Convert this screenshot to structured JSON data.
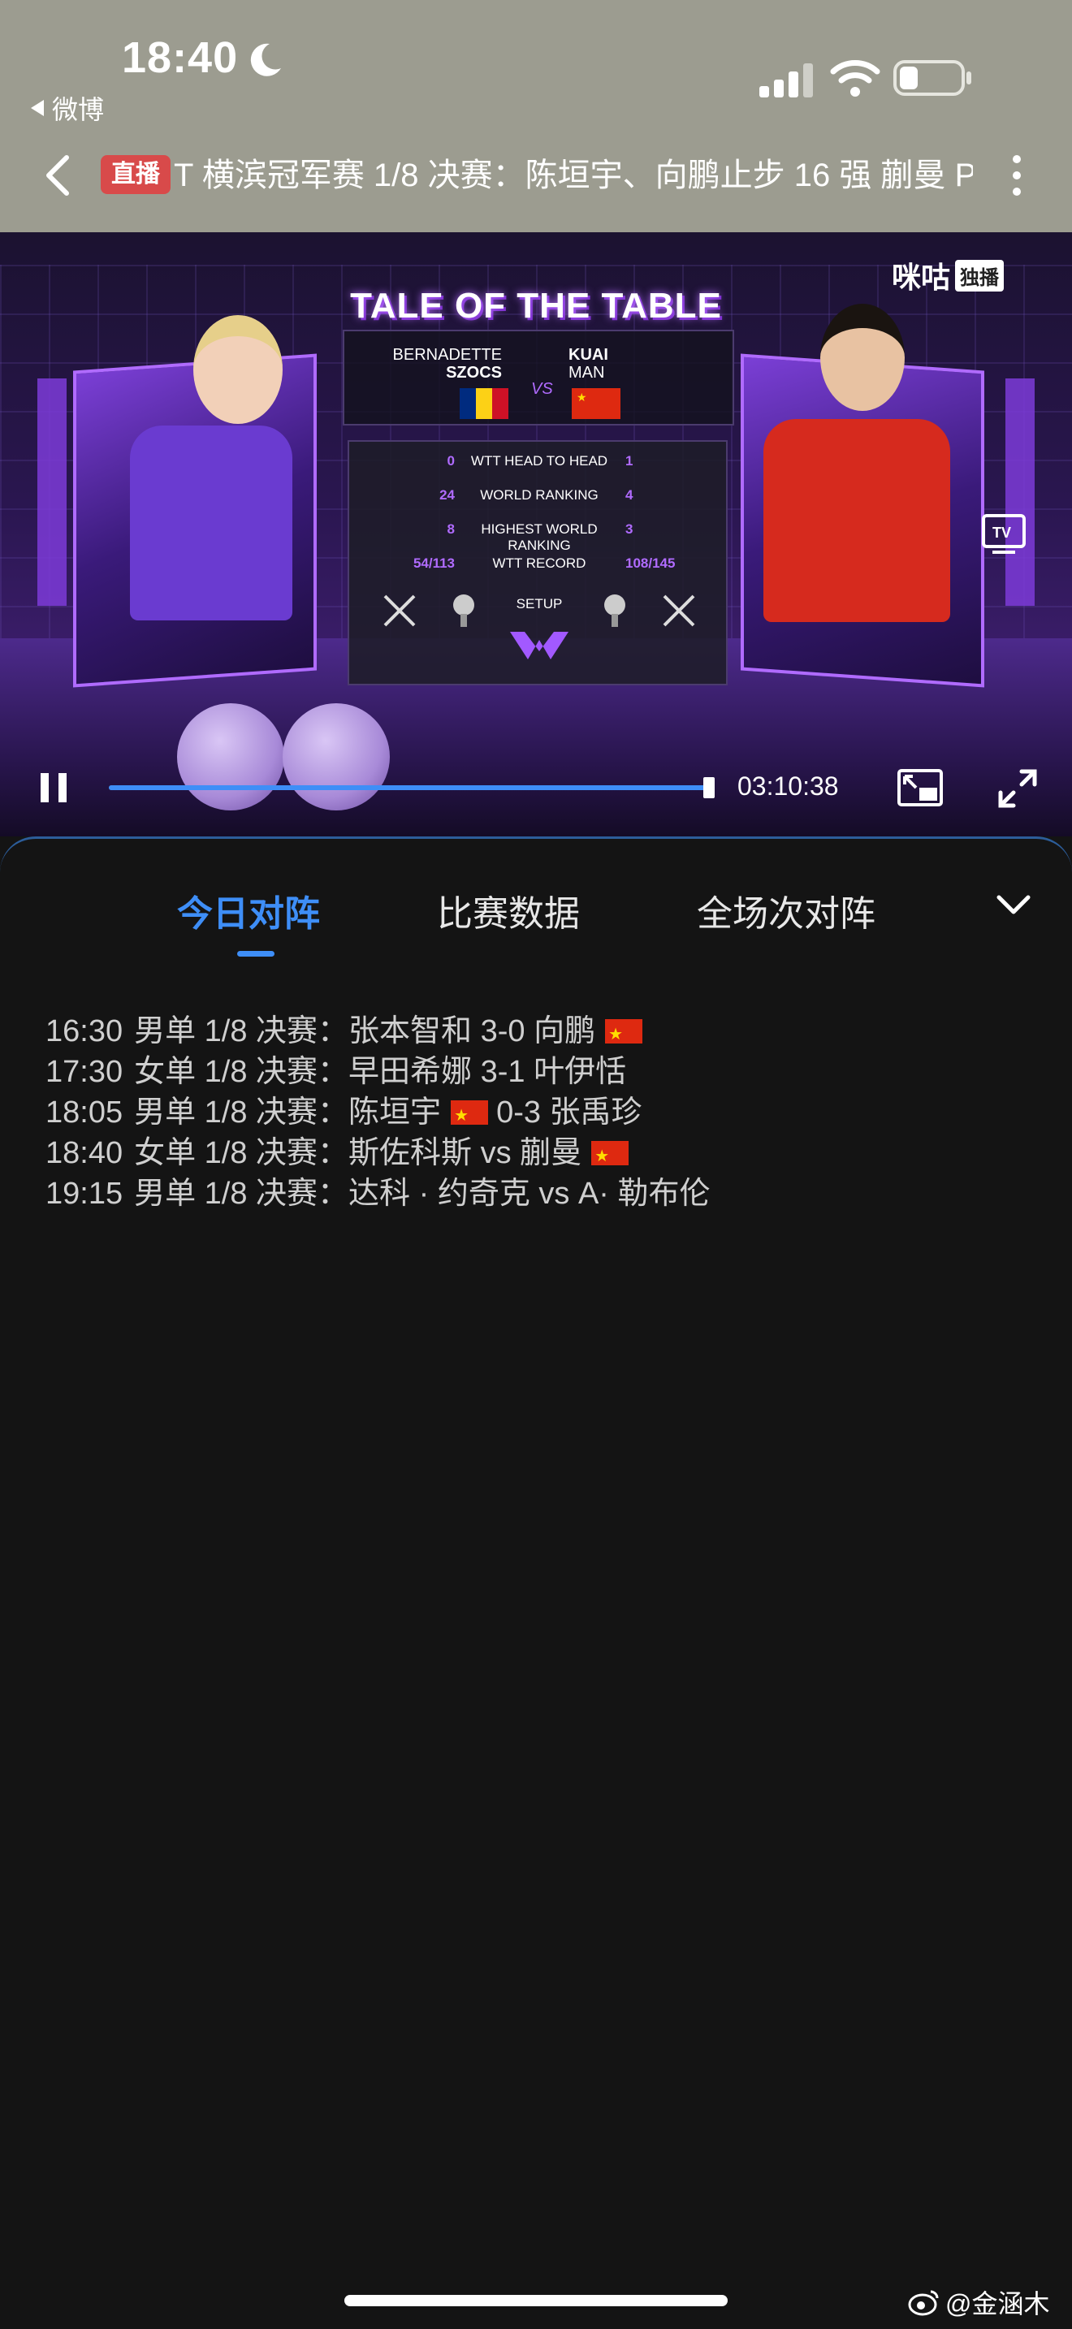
{
  "status_bar": {
    "time": "18:40",
    "back_app_label": "微博"
  },
  "header": {
    "live_badge": "直播",
    "title": "T 横滨冠军赛 1/8 决赛：陈垣宇、向鹏止步 16 强 蒯曼 P"
  },
  "video": {
    "channel_logo": "咪咕",
    "channel_tag": "独播",
    "overlay_title": "TALE OF THE TABLE",
    "player_left": {
      "first": "BERNADETTE",
      "last": "SZOCS"
    },
    "player_right": {
      "first": "KUAI",
      "last": "MAN"
    },
    "vs": "VS",
    "stats": [
      {
        "left": "0",
        "label": "WTT HEAD TO HEAD",
        "right": "1"
      },
      {
        "left": "24",
        "label": "WORLD RANKING",
        "right": "4"
      },
      {
        "left": "8",
        "label": "HIGHEST WORLD RANKING",
        "right": "3"
      },
      {
        "left": "54/113",
        "label": "WTT RECORD",
        "right": "108/145"
      }
    ],
    "setup_label": "SETUP",
    "tv_label": "TV",
    "progress_fraction": 0.99,
    "time_readout": "03:10:38"
  },
  "tabs": [
    {
      "label": "今日对阵",
      "active": true
    },
    {
      "label": "比赛数据",
      "active": false
    },
    {
      "label": "全场次对阵",
      "active": false
    }
  ],
  "schedule": [
    {
      "time": "16:30",
      "event": "男单 1/8 决赛：",
      "p1": "张本智和",
      "score": "3-0",
      "p2": "向鹏",
      "flag_after": "p2"
    },
    {
      "time": "17:30",
      "event": "女单 1/8 决赛：",
      "p1": "早田希娜",
      "score": "3-1",
      "p2": "叶伊恬",
      "flag_after": ""
    },
    {
      "time": "18:05",
      "event": "男单 1/8 决赛：",
      "p1": "陈垣宇",
      "score": "0-3",
      "p2": "张禹珍",
      "flag_after": "p1"
    },
    {
      "time": "18:40",
      "event": "女单 1/8 决赛：",
      "p1": "斯佐科斯",
      "score": "vs",
      "p2": "蒯曼",
      "flag_after": "p2"
    },
    {
      "time": "19:15",
      "event": "男单 1/8 决赛：",
      "p1": "达科 · 约奇克",
      "score": "vs",
      "p2": "A· 勒布伦",
      "flag_after": ""
    }
  ],
  "watermark": "@金涵木",
  "colors": {
    "accent": "#3e8ef7",
    "live_red": "#d84a4a",
    "topbar": "#9c9c90",
    "overlay_purple": "#b06bff"
  }
}
